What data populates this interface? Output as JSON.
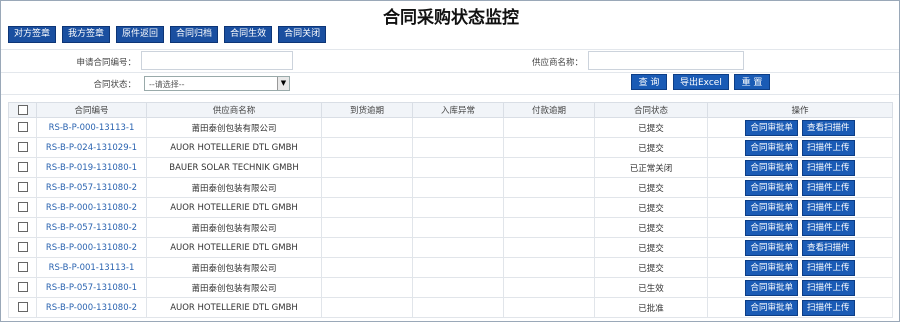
{
  "page": {
    "title": "合同采购状态监控"
  },
  "toolbar": [
    "对方签章",
    "我方签章",
    "原件返回",
    "合同归档",
    "合同生效",
    "合同关闭"
  ],
  "filters": {
    "apply_no_label": "申请合同编号：",
    "supplier_label": "供应商名称：",
    "status_label": "合同状态：",
    "status_value": "--请选择--"
  },
  "actions": {
    "query": "查 询",
    "export": "导出Excel",
    "reset": "重 置"
  },
  "table": {
    "headers": [
      "合同编号",
      "供应商名称",
      "到货逾期",
      "入库异常",
      "付款逾期",
      "合同状态",
      "操作"
    ],
    "rows": [
      {
        "code": "RS-B-P-000-13113-1",
        "supplier": "莆田泰创包装有限公司",
        "status": "已提交",
        "a1": "合同审批单",
        "a2": "查看扫描件"
      },
      {
        "code": "RS-B-P-024-131029-1",
        "supplier": "AUOR HOTELLERIE DTL GMBH",
        "status": "已提交",
        "a1": "合同审批单",
        "a2": "扫描件上传"
      },
      {
        "code": "RS-B-P-019-131080-1",
        "supplier": "BAUER SOLAR TECHNIK GMBH",
        "status": "已正常关闭",
        "a1": "合同审批单",
        "a2": "扫描件上传"
      },
      {
        "code": "RS-B-P-057-131080-2",
        "supplier": "莆田泰创包装有限公司",
        "status": "已提交",
        "a1": "合同审批单",
        "a2": "扫描件上传"
      },
      {
        "code": "RS-B-P-000-131080-2",
        "supplier": "AUOR HOTELLERIE DTL GMBH",
        "status": "已提交",
        "a1": "合同审批单",
        "a2": "扫描件上传"
      },
      {
        "code": "RS-B-P-057-131080-2",
        "supplier": "莆田泰创包装有限公司",
        "status": "已提交",
        "a1": "合同审批单",
        "a2": "扫描件上传"
      },
      {
        "code": "RS-B-P-000-131080-2",
        "supplier": "AUOR HOTELLERIE DTL GMBH",
        "status": "已提交",
        "a1": "合同审批单",
        "a2": "查看扫描件"
      },
      {
        "code": "RS-B-P-001-13113-1",
        "supplier": "莆田泰创包装有限公司",
        "status": "已提交",
        "a1": "合同审批单",
        "a2": "扫描件上传"
      },
      {
        "code": "RS-B-P-057-131080-1",
        "supplier": "莆田泰创包装有限公司",
        "status": "已生效",
        "a1": "合同审批单",
        "a2": "扫描件上传"
      },
      {
        "code": "RS-B-P-000-131080-2",
        "supplier": "AUOR HOTELLERIE DTL GMBH",
        "status": "已批准",
        "a1": "合同审批单",
        "a2": "扫描件上传"
      }
    ]
  }
}
